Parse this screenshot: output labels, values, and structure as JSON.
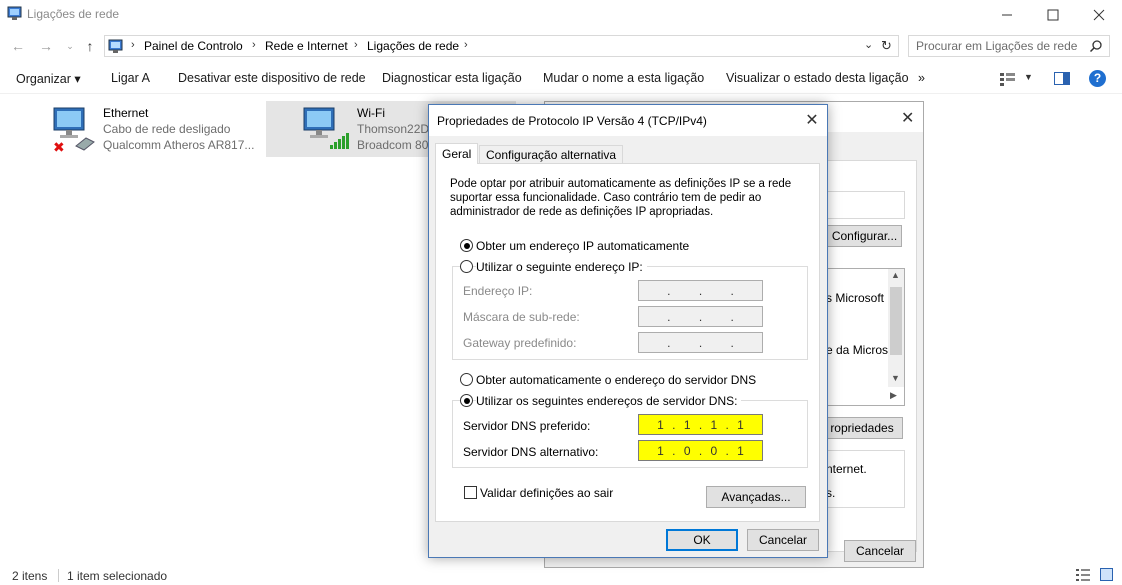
{
  "window": {
    "title": "Ligações de rede"
  },
  "address": {
    "breadcrumbs": [
      "Painel de Controlo",
      "Rede e Internet",
      "Ligações de rede"
    ],
    "search_placeholder": "Procurar em Ligações de rede"
  },
  "commands": [
    "Organizar ▾",
    "Ligar A",
    "Desativar este dispositivo de rede",
    "Diagnosticar esta ligação",
    "Mudar o nome a esta ligação",
    "Visualizar o estado desta ligação",
    "»"
  ],
  "connections": [
    {
      "name": "Ethernet",
      "status": "Cabo de rede desligado",
      "adapter": "Qualcomm Atheros AR817..."
    },
    {
      "name": "Wi-Fi",
      "status": "Thomson22D",
      "adapter": "Broadcom 80"
    }
  ],
  "statusbar": {
    "count": "2 itens",
    "selected": "1 item selecionado"
  },
  "bg_dialog": {
    "configure_button": "Configurar...",
    "list_lines": [
      "s Microsoft",
      "e da Microso"
    ],
    "properties_button": "ropriedades",
    "desc_line1": "nternet.",
    "desc_line2": "s.",
    "cancel_button": "Cancelar"
  },
  "dialog": {
    "title": "Propriedades de Protocolo IP Versão 4 (TCP/IPv4)",
    "tabs": [
      "Geral",
      "Configuração alternativa"
    ],
    "intro_line1": "Pode optar por atribuir automaticamente as definições IP se a rede",
    "intro_line2": "suportar essa funcionalidade. Caso contrário tem de pedir ao",
    "intro_line3": "administrador de rede as definições IP apropriadas.",
    "ip_auto": "Obter um endereço IP automaticamente",
    "ip_manual": "Utilizar o seguinte endereço IP:",
    "ip_address_label": "Endereço IP:",
    "subnet_label": "Máscara de sub-rede:",
    "gateway_label": "Gateway predefinido:",
    "dns_auto": "Obter automaticamente o endereço do servidor DNS",
    "dns_manual": "Utilizar os seguintes endereços de servidor DNS:",
    "dns_preferred_label": "Servidor DNS preferido:",
    "dns_preferred": [
      "1",
      "1",
      "1",
      "1"
    ],
    "dns_alternate_label": "Servidor DNS alternativo:",
    "dns_alternate": [
      "1",
      "0",
      "0",
      "1"
    ],
    "validate_label": "Validar definições ao sair",
    "advanced_button": "Avançadas...",
    "ok_button": "OK",
    "cancel_button": "Cancelar"
  },
  "colors": {
    "accent": "#0078d7",
    "dns_highlight": "#ffff00",
    "selection": "#e5e5e5"
  }
}
